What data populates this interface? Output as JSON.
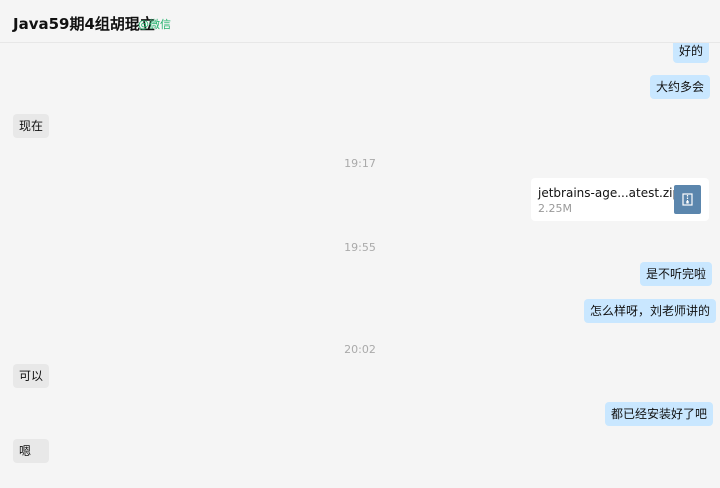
{
  "header": {
    "title": "Java59期4组胡琨立",
    "source": "@微信"
  },
  "messages": {
    "m1": "好的",
    "m2": "大约多会",
    "m3": "现在",
    "t1": "19:17",
    "file": {
      "name": "jetbrains-age...atest.zip",
      "size": "2.25M",
      "icon": "zip-file-icon"
    },
    "t2": "19:55",
    "m4": "是不听完啦",
    "m5": "怎么样呀，刘老师讲的",
    "t3": "20:02",
    "m6": "可以",
    "m7": "都已经安装好了吧",
    "m8": "嗯"
  },
  "colors": {
    "sent_bubble": "#c9e7ff",
    "received_bubble": "#e8e8e8",
    "source_tag": "#20b26b",
    "file_icon": "#5b86ad"
  }
}
